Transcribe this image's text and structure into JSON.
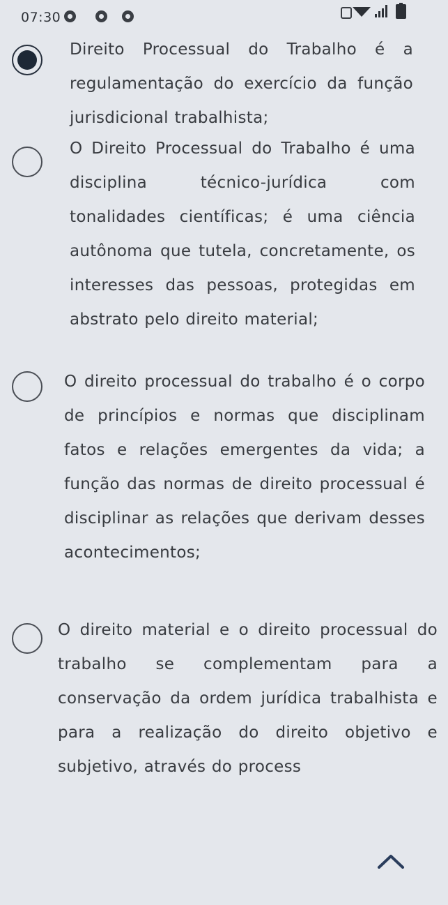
{
  "status_bar": {
    "time": "07:30"
  },
  "options": [
    {
      "selected": true,
      "text": "Direito Processual do Trabalho é a regulamentação do exercício da função jurisdicional trabalhista;"
    },
    {
      "selected": false,
      "text": "O Direito Processual do Trabalho é uma disciplina técnico-jurídica com tonalidades científicas; é uma ciência autônoma que tutela, concretamente, os interesses das pessoas, protegidas em abstrato pelo direito material;"
    },
    {
      "selected": false,
      "text": "O direito processual do trabalho é o corpo de princípios e normas que disciplinam fatos e relações emergentes da vida; a função das normas de direito processual é disciplinar as relações que derivam desses acontecimentos;"
    },
    {
      "selected": false,
      "text": "O direito material e o direito processual do trabalho se complementam para a conservação da ordem jurídica trabalhista e para a realização do direito objetivo e subjetivo, através do process"
    }
  ],
  "icons": {
    "collapse": "caret-up-icon"
  },
  "colors": {
    "background": "#e4e7ec",
    "text": "#383b40",
    "radio_selected": "#1d2836"
  }
}
